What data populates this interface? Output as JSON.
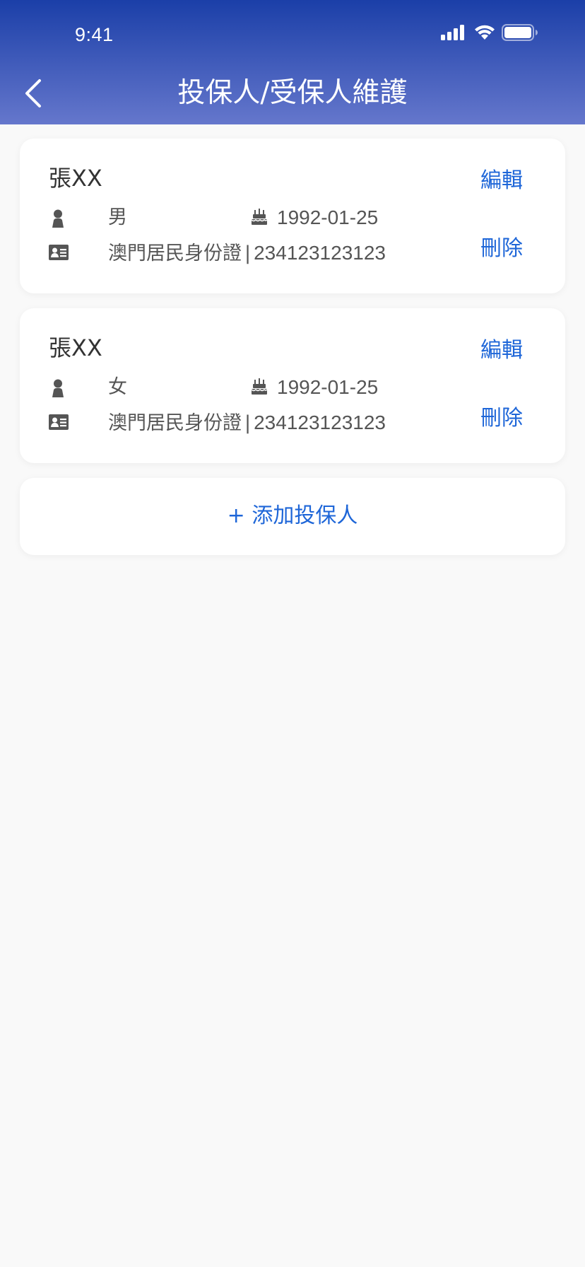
{
  "status_bar": {
    "time": "9:41",
    "icons": [
      "signal-icon",
      "wifi-icon",
      "battery-icon"
    ]
  },
  "header": {
    "title": "投保人/受保人維護",
    "back_icon": "chevron-left-icon"
  },
  "colors": {
    "header_gradient_top": "#1b3fa8",
    "header_gradient_bottom": "#6577cc",
    "accent": "#1e66d8",
    "background": "#f9f9f9",
    "card": "#ffffff",
    "icon_gray": "#555555"
  },
  "insured_list": [
    {
      "name": "張XX",
      "gender": "男",
      "birthday": "1992-01-25",
      "id_type": "澳門居民身份證",
      "id_separator": "|",
      "id_number": "234123123123",
      "edit_label": "編輯",
      "delete_label": "刪除"
    },
    {
      "name": "張XX",
      "gender": "女",
      "birthday": "1992-01-25",
      "id_type": "澳門居民身份證",
      "id_separator": "|",
      "id_number": "234123123123",
      "edit_label": "編輯",
      "delete_label": "刪除"
    }
  ],
  "add_button": {
    "label": "+ 添加投保人"
  }
}
